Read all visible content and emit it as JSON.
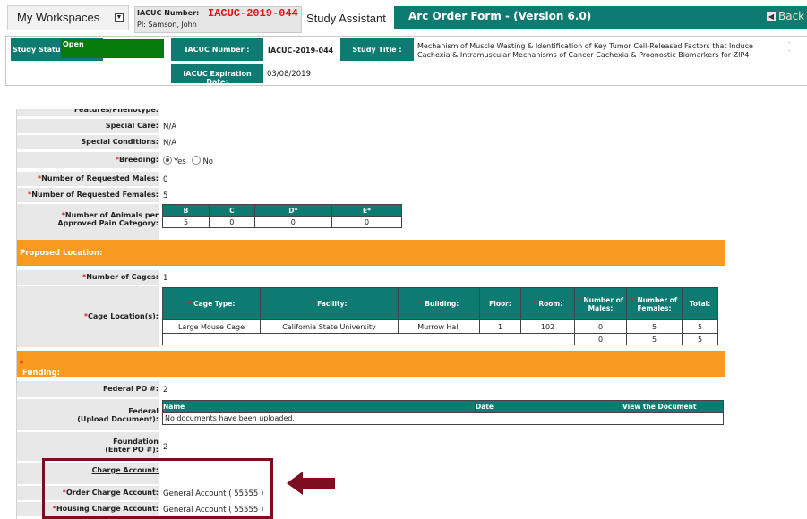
{
  "header": {
    "workspaces_label": "My Workspaces",
    "dropdown_icon": "▼",
    "iacuc_label": "IACUC Number:",
    "iacuc_number": "IACUC-2019-044",
    "pi": "PI: Samson, John",
    "study_assistant": "Study Assistant",
    "form_title": "Arc Order Form - (Version 6.0)",
    "back_label": "Back",
    "back_icon": "◀"
  },
  "status": {
    "study_status_label": "Study Status:",
    "study_status": "Open",
    "iacuc_number_label": "IACUC Number :",
    "iacuc_number": "IACUC-2019-044",
    "study_title_label": "Study Title :",
    "study_title": "Mechanism of Muscle Wasting & Identification of Key Tumor Cell-Released Factors that Induce Cachexia & Intramuscular Mechanisms of Cancer Cachexia & Proonostic Biomarkers for ZIP4-",
    "expiration_label": "IACUC Expiration Date:",
    "expiration_date": "03/08/2019"
  },
  "form": {
    "cut_label": "Features/Phenotype:",
    "special_care_label": "Special Care:",
    "special_care": "N/A",
    "special_conditions_label": "Special Conditions:",
    "special_conditions": "N/A",
    "breeding_label": "Breeding:",
    "breeding_yes": "Yes",
    "breeding_no": "No",
    "breeding_selected": "Yes",
    "males_label": "Number of Requested Males:",
    "males": "0",
    "females_label": "Number of Requested Females:",
    "females": "5",
    "pain_label_1": "Number of Animals per",
    "pain_label_2": "Approved Pain Category:",
    "pain_headers": [
      "B",
      "C",
      "D*",
      "E*"
    ],
    "pain_values": [
      "5",
      "0",
      "0",
      "0"
    ],
    "proposed_location": "Proposed Location:",
    "cages_label": "Number of Cages:",
    "cages": "1",
    "cage_location_label": "Cage Location(s):",
    "cage_headers": [
      "Cage Type:",
      "Facility:",
      "Building:",
      "Floor:",
      "Room:",
      "Number of Males:",
      "Number of Females:",
      "Total:"
    ],
    "cage_rows": [
      [
        "Large Mouse Cage",
        "California State University",
        "Murrow Hall",
        "1",
        "102",
        "0",
        "5",
        "5"
      ],
      [
        "",
        "",
        "",
        "",
        "",
        "0",
        "5",
        "5"
      ]
    ],
    "funding": "Funding:",
    "federal_po_label": "Federal PO #:",
    "federal_po": "2",
    "federal_label_1": "Federal",
    "federal_label_2": "(Upload Document):",
    "doc_headers": [
      "Name",
      "Date",
      "View the Document"
    ],
    "doc_empty": "No documents have been uploaded.",
    "foundation_label_1": "Foundation",
    "foundation_label_2": "(Enter PO #):",
    "foundation": "2",
    "charge_account_label": "Charge Account:",
    "order_charge_label": "Order Charge Account:",
    "order_charge": "General Account ( 55555 )",
    "housing_charge_label": "Housing Charge Account:",
    "housing_charge": "General Account ( 55555 )"
  },
  "colors": {
    "teal": "#0e7b73",
    "orange": "#f89a1f",
    "green": "#087a0b",
    "red": "#e3131b",
    "highlight": "#7d0e1f"
  }
}
